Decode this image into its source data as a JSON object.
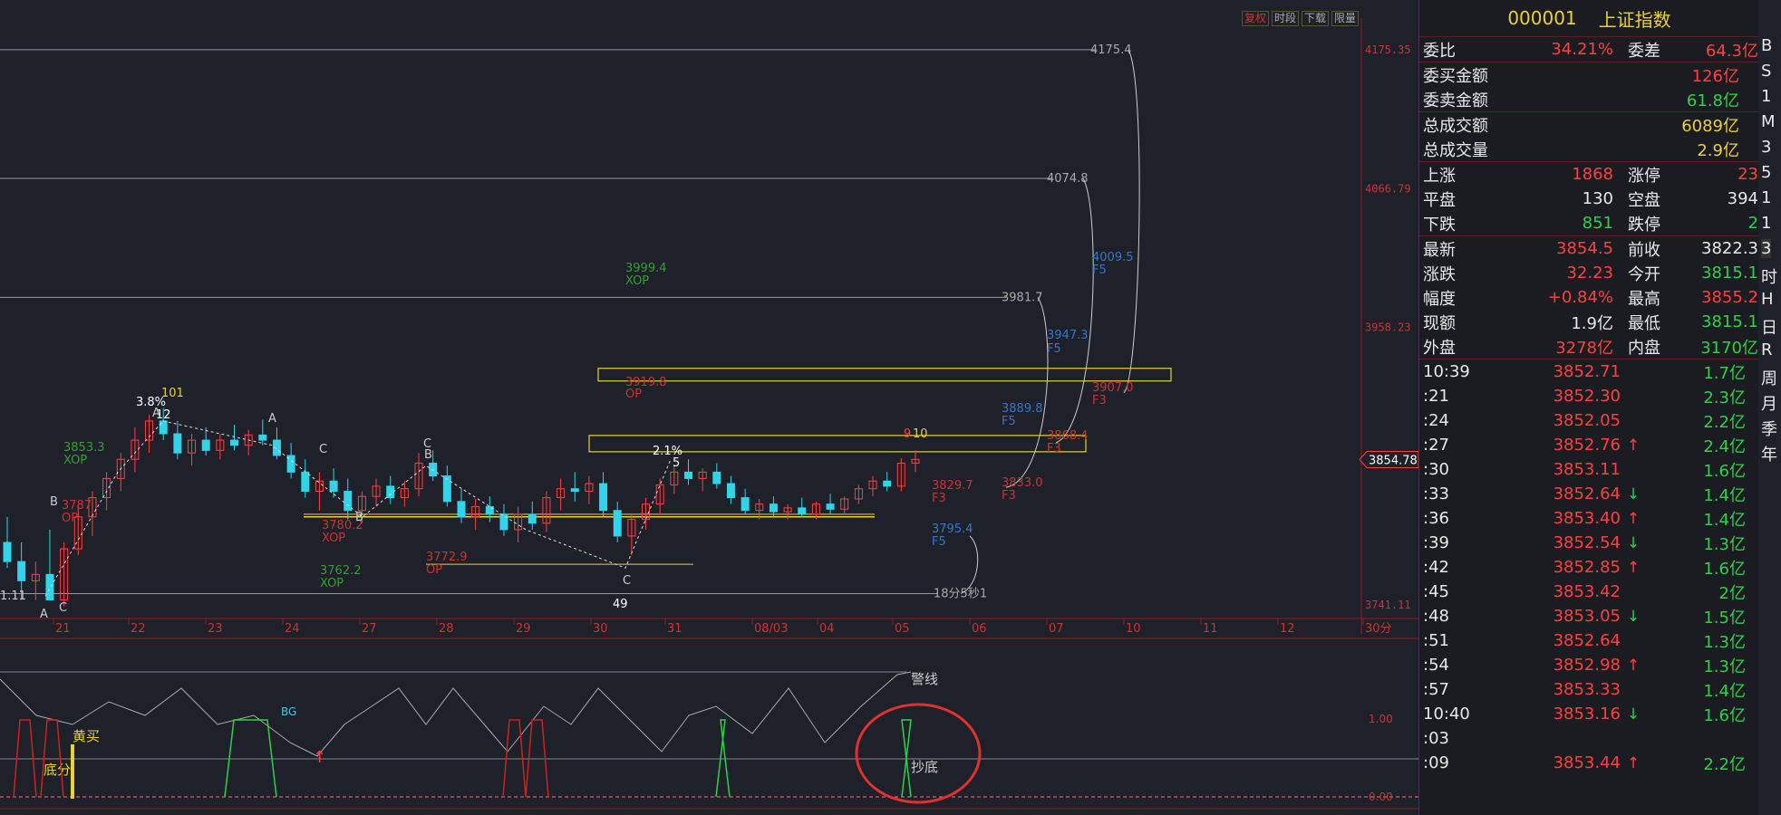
{
  "toolbar": {
    "buttons": [
      "复权",
      "时段",
      "下载",
      "限量"
    ]
  },
  "chart_data": {
    "type": "candlestick",
    "y_ticks": [
      "4175.35",
      "4066.79",
      "3958.23",
      "3741.11"
    ],
    "x_ticks": [
      "21",
      "22",
      "23",
      "24",
      "27",
      "28",
      "29",
      "30",
      "31",
      "08/03",
      "04",
      "05",
      "06",
      "07",
      "10",
      "11",
      "12",
      "30分"
    ],
    "current_price_label": "3854.78",
    "candles": [
      {
        "o": 3790,
        "h": 3810,
        "l": 3770,
        "c": 3775
      },
      {
        "o": 3775,
        "h": 3790,
        "l": 3745,
        "c": 3760
      },
      {
        "o": 3760,
        "h": 3775,
        "l": 3745,
        "c": 3765
      },
      {
        "o": 3765,
        "h": 3800,
        "l": 3750,
        "c": 3745
      },
      {
        "o": 3745,
        "h": 3790,
        "l": 3740,
        "c": 3785
      },
      {
        "o": 3785,
        "h": 3820,
        "l": 3780,
        "c": 3810
      },
      {
        "o": 3810,
        "h": 3830,
        "l": 3795,
        "c": 3825
      },
      {
        "o": 3825,
        "h": 3845,
        "l": 3815,
        "c": 3840
      },
      {
        "o": 3840,
        "h": 3860,
        "l": 3830,
        "c": 3855
      },
      {
        "o": 3855,
        "h": 3880,
        "l": 3845,
        "c": 3870
      },
      {
        "o": 3870,
        "h": 3890,
        "l": 3860,
        "c": 3885
      },
      {
        "o": 3885,
        "h": 3895,
        "l": 3870,
        "c": 3875
      },
      {
        "o": 3875,
        "h": 3885,
        "l": 3855,
        "c": 3860
      },
      {
        "o": 3860,
        "h": 3875,
        "l": 3850,
        "c": 3870
      },
      {
        "o": 3870,
        "h": 3880,
        "l": 3858,
        "c": 3862
      },
      {
        "o": 3862,
        "h": 3875,
        "l": 3855,
        "c": 3870
      },
      {
        "o": 3870,
        "h": 3882,
        "l": 3862,
        "c": 3866
      },
      {
        "o": 3866,
        "h": 3878,
        "l": 3858,
        "c": 3874
      },
      {
        "o": 3874,
        "h": 3886,
        "l": 3866,
        "c": 3870
      },
      {
        "o": 3870,
        "h": 3880,
        "l": 3855,
        "c": 3858
      },
      {
        "o": 3858,
        "h": 3868,
        "l": 3840,
        "c": 3845
      },
      {
        "o": 3845,
        "h": 3855,
        "l": 3825,
        "c": 3830
      },
      {
        "o": 3830,
        "h": 3845,
        "l": 3815,
        "c": 3838
      },
      {
        "o": 3838,
        "h": 3848,
        "l": 3825,
        "c": 3830
      },
      {
        "o": 3830,
        "h": 3840,
        "l": 3808,
        "c": 3815
      },
      {
        "o": 3815,
        "h": 3830,
        "l": 3805,
        "c": 3826
      },
      {
        "o": 3826,
        "h": 3840,
        "l": 3818,
        "c": 3834
      },
      {
        "o": 3834,
        "h": 3842,
        "l": 3820,
        "c": 3825
      },
      {
        "o": 3825,
        "h": 3838,
        "l": 3818,
        "c": 3832
      },
      {
        "o": 3832,
        "h": 3860,
        "l": 3826,
        "c": 3852
      },
      {
        "o": 3852,
        "h": 3862,
        "l": 3838,
        "c": 3842
      },
      {
        "o": 3842,
        "h": 3850,
        "l": 3818,
        "c": 3822
      },
      {
        "o": 3822,
        "h": 3832,
        "l": 3805,
        "c": 3810
      },
      {
        "o": 3810,
        "h": 3824,
        "l": 3800,
        "c": 3818
      },
      {
        "o": 3818,
        "h": 3826,
        "l": 3806,
        "c": 3812
      },
      {
        "o": 3812,
        "h": 3820,
        "l": 3795,
        "c": 3800
      },
      {
        "o": 3800,
        "h": 3818,
        "l": 3790,
        "c": 3812
      },
      {
        "o": 3812,
        "h": 3822,
        "l": 3800,
        "c": 3805
      },
      {
        "o": 3805,
        "h": 3830,
        "l": 3798,
        "c": 3825
      },
      {
        "o": 3825,
        "h": 3840,
        "l": 3815,
        "c": 3832
      },
      {
        "o": 3832,
        "h": 3845,
        "l": 3822,
        "c": 3830
      },
      {
        "o": 3830,
        "h": 3842,
        "l": 3820,
        "c": 3836
      },
      {
        "o": 3836,
        "h": 3845,
        "l": 3810,
        "c": 3815
      },
      {
        "o": 3815,
        "h": 3822,
        "l": 3790,
        "c": 3795
      },
      {
        "o": 3795,
        "h": 3812,
        "l": 3780,
        "c": 3808
      },
      {
        "o": 3808,
        "h": 3825,
        "l": 3800,
        "c": 3820
      },
      {
        "o": 3820,
        "h": 3840,
        "l": 3812,
        "c": 3835
      },
      {
        "o": 3835,
        "h": 3850,
        "l": 3828,
        "c": 3845
      },
      {
        "o": 3845,
        "h": 3855,
        "l": 3835,
        "c": 3840
      },
      {
        "o": 3840,
        "h": 3848,
        "l": 3830,
        "c": 3845
      },
      {
        "o": 3845,
        "h": 3852,
        "l": 3832,
        "c": 3836
      },
      {
        "o": 3836,
        "h": 3842,
        "l": 3820,
        "c": 3825
      },
      {
        "o": 3825,
        "h": 3832,
        "l": 3812,
        "c": 3815
      },
      {
        "o": 3815,
        "h": 3824,
        "l": 3808,
        "c": 3820
      },
      {
        "o": 3820,
        "h": 3826,
        "l": 3810,
        "c": 3814
      },
      {
        "o": 3814,
        "h": 3820,
        "l": 3808,
        "c": 3817
      },
      {
        "o": 3817,
        "h": 3825,
        "l": 3810,
        "c": 3812
      },
      {
        "o": 3812,
        "h": 3822,
        "l": 3808,
        "c": 3820
      },
      {
        "o": 3820,
        "h": 3828,
        "l": 3812,
        "c": 3816
      },
      {
        "o": 3816,
        "h": 3826,
        "l": 3812,
        "c": 3824
      },
      {
        "o": 3824,
        "h": 3835,
        "l": 3820,
        "c": 3832
      },
      {
        "o": 3832,
        "h": 3842,
        "l": 3826,
        "c": 3838
      },
      {
        "o": 3838,
        "h": 3845,
        "l": 3830,
        "c": 3834
      },
      {
        "o": 3834,
        "h": 3856,
        "l": 3830,
        "c": 3852
      },
      {
        "o": 3852,
        "h": 3862,
        "l": 3845,
        "c": 3855
      }
    ],
    "h_levels": [
      {
        "v": "4175.4"
      },
      {
        "v": "4074.8"
      },
      {
        "v": "3981.7"
      },
      {
        "v": "18分5秒1"
      }
    ],
    "annotations": [
      "3999.4",
      "XOP",
      "3919.8",
      "OP",
      "3907.0",
      "F3",
      "4009.5",
      "F5",
      "3947.3",
      "F5",
      "3889.8",
      "F5",
      "3868.4",
      "F3",
      "3833.0",
      "F3",
      "3829.7",
      "F3",
      "3795.4",
      "F5",
      "3853.3",
      "XOP",
      "3787",
      "OP",
      "3762.2",
      "XOP",
      "3772.9",
      "OP",
      "3780.2",
      "XOP",
      "2.1%",
      "3.8%",
      "12",
      "101",
      "10",
      "9",
      "5",
      "49",
      "A",
      "B",
      "C",
      "A",
      "B",
      "C",
      "C",
      "B",
      "C",
      "1.11",
      "A"
    ],
    "indicator": {
      "labels": [
        "警线",
        "抄底",
        "黄买",
        "底分",
        "BG"
      ],
      "y_ticks": [
        "1.00",
        "0.00"
      ]
    }
  },
  "panel": {
    "code": "000001",
    "name": "上证指数",
    "r1": [
      {
        "label": "委比",
        "value": "34.21%",
        "color": "red"
      },
      {
        "label": "委差",
        "value": "64.3亿",
        "color": "red"
      }
    ],
    "buy_amt": {
      "label": "委买金额",
      "value": "126亿"
    },
    "sell_amt": {
      "label": "委卖金额",
      "value": "61.8亿"
    },
    "turnover": {
      "label": "总成交额",
      "value": "6089亿"
    },
    "volume": {
      "label": "总成交量",
      "value": "2.9亿"
    },
    "breadth": [
      {
        "l1": "上涨",
        "v1": "1868",
        "c1": "red",
        "l2": "涨停",
        "v2": "23",
        "c2": "red"
      },
      {
        "l1": "平盘",
        "v1": "130",
        "c1": "white",
        "l2": "空盘",
        "v2": "394",
        "c2": "white"
      },
      {
        "l1": "下跌",
        "v1": "851",
        "c1": "green",
        "l2": "跌停",
        "v2": "2",
        "c2": "green"
      }
    ],
    "quote": [
      {
        "l1": "最新",
        "v1": "3854.5",
        "c1": "red",
        "l2": "前收",
        "v2": "3822.3",
        "c2": "white"
      },
      {
        "l1": "涨跌",
        "v1": "32.23",
        "c1": "red",
        "l2": "今开",
        "v2": "3815.1",
        "c2": "green"
      },
      {
        "l1": "幅度",
        "v1": "+0.84%",
        "c1": "red",
        "l2": "最高",
        "v2": "3855.2",
        "c2": "red"
      },
      {
        "l1": "现额",
        "v1": "1.9亿",
        "c1": "white",
        "l2": "最低",
        "v2": "3815.1",
        "c2": "green"
      },
      {
        "l1": "外盘",
        "v1": "3278亿",
        "c1": "red",
        "l2": "内盘",
        "v2": "3170亿",
        "c2": "green"
      }
    ],
    "ticks": [
      {
        "t": "10:39",
        "p": "3852.71",
        "a": "",
        "v": "1.7亿"
      },
      {
        "t": ":21",
        "p": "3852.30",
        "a": "",
        "v": "2.3亿"
      },
      {
        "t": ":24",
        "p": "3852.05",
        "a": "",
        "v": "2.2亿"
      },
      {
        "t": ":27",
        "p": "3852.76",
        "a": "↑",
        "v": "2.4亿"
      },
      {
        "t": ":30",
        "p": "3853.11",
        "a": "",
        "v": "1.6亿"
      },
      {
        "t": ":33",
        "p": "3852.64",
        "a": "↓",
        "v": "1.4亿"
      },
      {
        "t": ":36",
        "p": "3853.40",
        "a": "↑",
        "v": "1.4亿"
      },
      {
        "t": ":39",
        "p": "3852.54",
        "a": "↓",
        "v": "1.3亿"
      },
      {
        "t": ":42",
        "p": "3852.85",
        "a": "↑",
        "v": "1.6亿"
      },
      {
        "t": ":45",
        "p": "3853.42",
        "a": "",
        "v": "2亿"
      },
      {
        "t": ":48",
        "p": "3853.05",
        "a": "↓",
        "v": "1.5亿"
      },
      {
        "t": ":51",
        "p": "3852.64",
        "a": "",
        "v": "1.3亿"
      },
      {
        "t": ":54",
        "p": "3852.98",
        "a": "↑",
        "v": "1.3亿"
      },
      {
        "t": ":57",
        "p": "3853.33",
        "a": "",
        "v": "1.4亿"
      },
      {
        "t": "10:40",
        "p": "3853.16",
        "a": "↓",
        "v": "1.6亿"
      },
      {
        "t": ":03",
        "p": "",
        "a": "",
        "v": ""
      },
      {
        "t": ":09",
        "p": "3853.44",
        "a": "↑",
        "v": "2.2亿"
      }
    ]
  },
  "edge": {
    "items": [
      "B",
      "S",
      "1",
      "M",
      "3",
      "5",
      "1",
      "1",
      "3",
      "时",
      "H",
      "日",
      "R",
      "周",
      "月",
      "季",
      "年"
    ]
  }
}
